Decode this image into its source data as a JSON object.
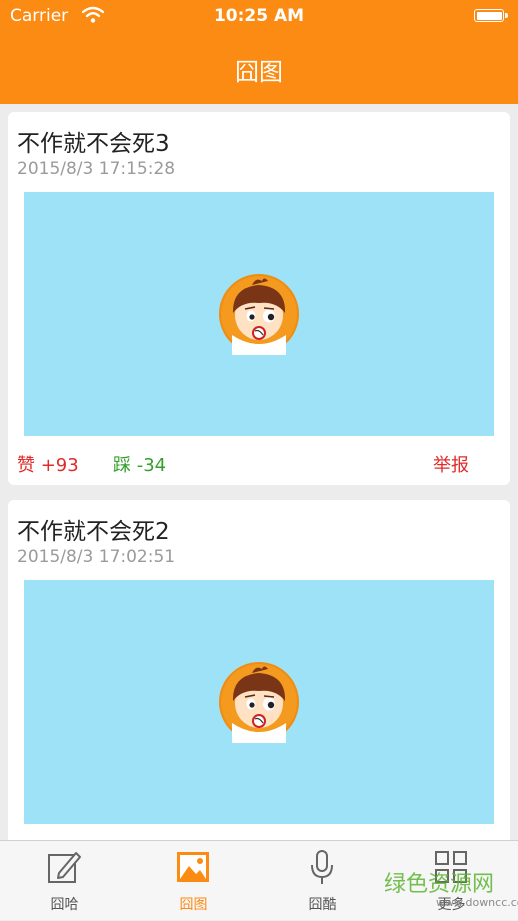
{
  "status_bar": {
    "carrier": "Carrier",
    "time": "10:25 AM"
  },
  "nav": {
    "title": "囧图"
  },
  "posts": [
    {
      "title": "不作就不会死3",
      "date": "2015/8/3 17:15:28",
      "like": "赞 +93",
      "dislike": "踩 -34",
      "report": "举报"
    },
    {
      "title": "不作就不会死2",
      "date": "2015/8/3 17:02:51"
    }
  ],
  "tabs": [
    {
      "label": "囧哈",
      "icon": "edit-icon"
    },
    {
      "label": "囧图",
      "icon": "image-icon",
      "active": true
    },
    {
      "label": "囧酷",
      "icon": "microphone-icon"
    },
    {
      "label": "更多",
      "icon": "grid-icon"
    }
  ],
  "watermark": {
    "text": "绿色资源网",
    "sub": "www.downcc.com"
  },
  "colors": {
    "accent": "#fb8b13",
    "like": "#e02a2a",
    "dislike": "#34a02c",
    "image_bg": "#9ee2f8"
  }
}
